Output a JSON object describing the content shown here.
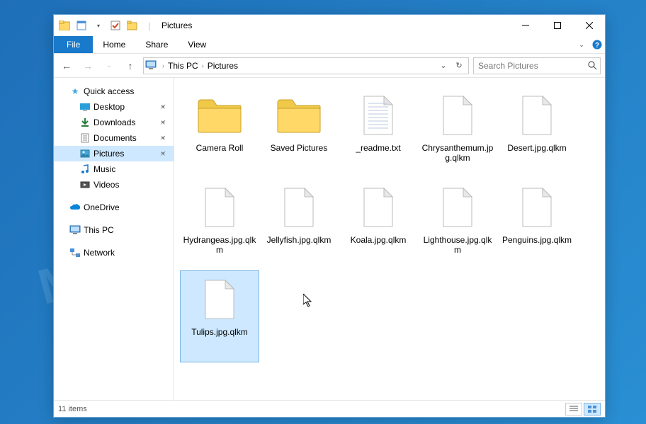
{
  "window": {
    "title": "Pictures"
  },
  "ribbon": {
    "file": "File",
    "tabs": [
      "Home",
      "Share",
      "View"
    ]
  },
  "breadcrumb": [
    "This PC",
    "Pictures"
  ],
  "search": {
    "placeholder": "Search Pictures"
  },
  "sidebar": {
    "quick_access": {
      "label": "Quick access"
    },
    "quick_items": [
      {
        "label": "Desktop",
        "pinned": true,
        "icon": "desktop"
      },
      {
        "label": "Downloads",
        "pinned": true,
        "icon": "downloads"
      },
      {
        "label": "Documents",
        "pinned": true,
        "icon": "documents"
      },
      {
        "label": "Pictures",
        "pinned": true,
        "icon": "pictures",
        "selected": true
      },
      {
        "label": "Music",
        "pinned": false,
        "icon": "music"
      },
      {
        "label": "Videos",
        "pinned": false,
        "icon": "videos"
      }
    ],
    "onedrive": {
      "label": "OneDrive"
    },
    "thispc": {
      "label": "This PC"
    },
    "network": {
      "label": "Network"
    }
  },
  "items": [
    {
      "name": "Camera Roll",
      "type": "folder"
    },
    {
      "name": "Saved Pictures",
      "type": "folder"
    },
    {
      "name": "_readme.txt",
      "type": "text"
    },
    {
      "name": "Chrysanthemum.jpg.qlkm",
      "type": "file"
    },
    {
      "name": "Desert.jpg.qlkm",
      "type": "file"
    },
    {
      "name": "Hydrangeas.jpg.qlkm",
      "type": "file"
    },
    {
      "name": "Jellyfish.jpg.qlkm",
      "type": "file"
    },
    {
      "name": "Koala.jpg.qlkm",
      "type": "file"
    },
    {
      "name": "Lighthouse.jpg.qlkm",
      "type": "file"
    },
    {
      "name": "Penguins.jpg.qlkm",
      "type": "file"
    },
    {
      "name": "Tulips.jpg.qlkm",
      "type": "file",
      "selected": true
    }
  ],
  "status": {
    "count_label": "11 items"
  },
  "watermark": "MYANTISPYWARE.COM"
}
